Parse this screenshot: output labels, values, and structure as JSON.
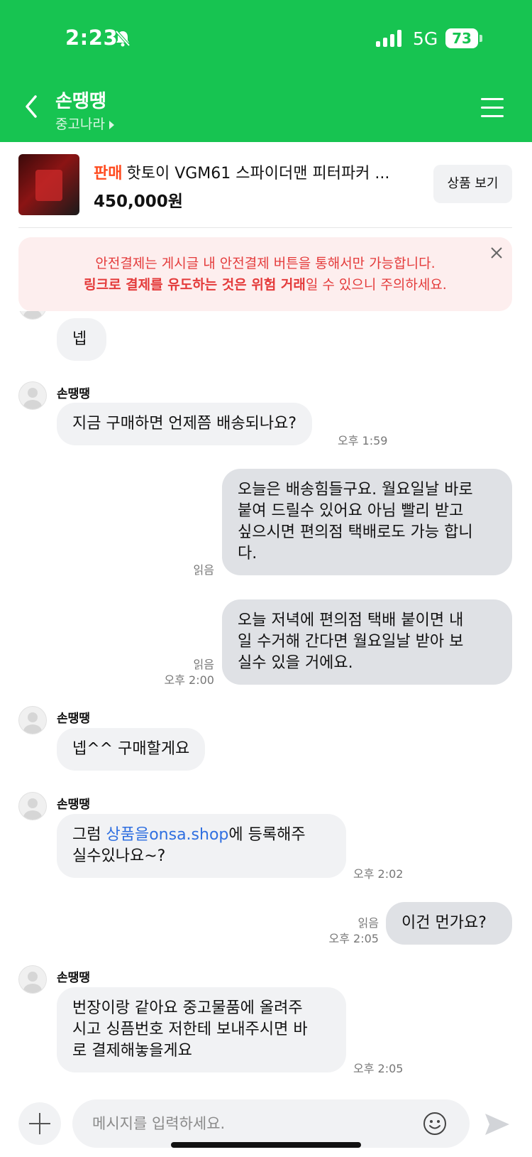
{
  "status": {
    "time": "2:23",
    "network": "5G",
    "battery": "73"
  },
  "header": {
    "title": "손땡땡",
    "subtitle": "중고나라"
  },
  "product": {
    "tag": "판매",
    "name": "핫토이 VGM61 스파이더맨 피터파커 ...",
    "price": "450,000원",
    "view_button": "상품 보기"
  },
  "warning": {
    "line1": "안전결제는 게시글 내 안전결제 버튼을 통해서만 가능합니다.",
    "line2_bold": "링크로 결제를 유도하는 것은 위험 거래",
    "line2_rest": "일 수 있으니 주의하세요."
  },
  "messages": {
    "m1": {
      "text": "넵"
    },
    "m2": {
      "sender": "손땡땡",
      "text": "지금 구매하면 언제쯤 배송되나요?",
      "time": "오후 1:59"
    },
    "m3": {
      "text": "오늘은 배송힘들구요. 월요일날 바로\n붙여 드릴수 있어요 아님 빨리 받고\n싶으시면 편의점 택배로도 가능 합니\n다.",
      "read": "읽음"
    },
    "m4": {
      "text": "오늘 저녁에 편의점 택배 붙이면 내\n일 수거해 간다면 월요일날 받아 보\n실수 있을 거에요.",
      "read": "읽음",
      "time": "오후 2:00"
    },
    "m5": {
      "sender": "손땡땡",
      "text": "넵^^ 구매할게요"
    },
    "m6": {
      "sender": "손땡땡",
      "prefix": "그럼 ",
      "link": "상품을onsa.shop",
      "suffix": "에 등록해주\n실수있나요~?",
      "time": "오후 2:02"
    },
    "m7": {
      "text": "이건 먼가요?",
      "read": "읽음",
      "time": "오후 2:05"
    },
    "m8": {
      "sender": "손땡땡",
      "text": "번장이랑 같아요 중고물품에 올려주\n시고 싱픔번호 저한테 보내주시면 바\n로 결제해놓을게요",
      "time": "오후 2:05"
    }
  },
  "composer": {
    "placeholder": "메시지를 입력하세요."
  }
}
